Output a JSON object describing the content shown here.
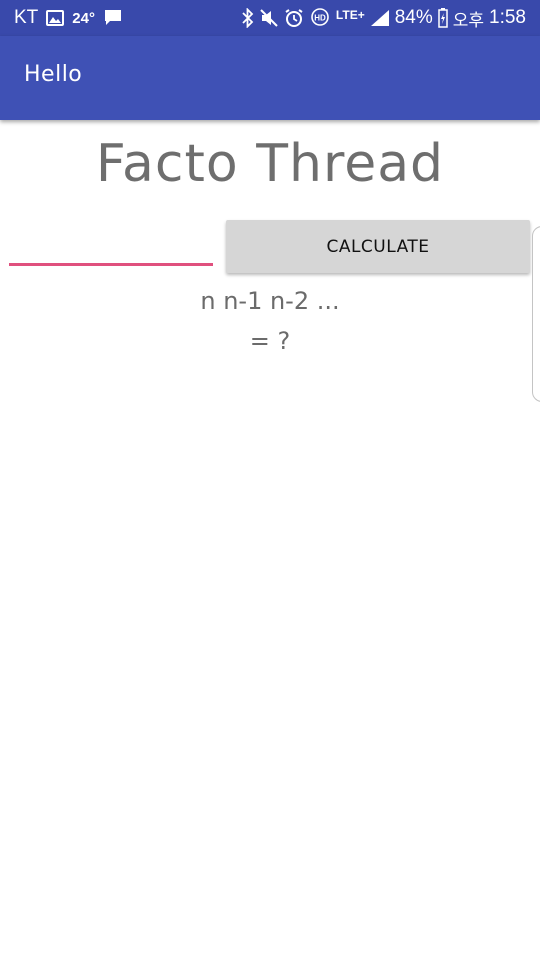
{
  "status_bar": {
    "carrier": "KT",
    "temperature": "24°",
    "network": "LTE+",
    "battery_percent": "84%",
    "ampm": "오후",
    "time": "1:58",
    "icons": [
      "gallery-icon",
      "message-icon",
      "bluetooth-icon",
      "mute-icon",
      "alarm-icon",
      "hd-voice-icon",
      "signal-icon",
      "battery-icon"
    ]
  },
  "app_bar": {
    "title": "Hello",
    "color": "#3f51b5"
  },
  "main": {
    "headline": "Facto Thread",
    "number_input": {
      "value": "",
      "placeholder": "",
      "underline_color": "#e0507e"
    },
    "calculate_button": "CALCULATE",
    "formula": "n n-1 n-2 ...",
    "result": "= ?"
  }
}
